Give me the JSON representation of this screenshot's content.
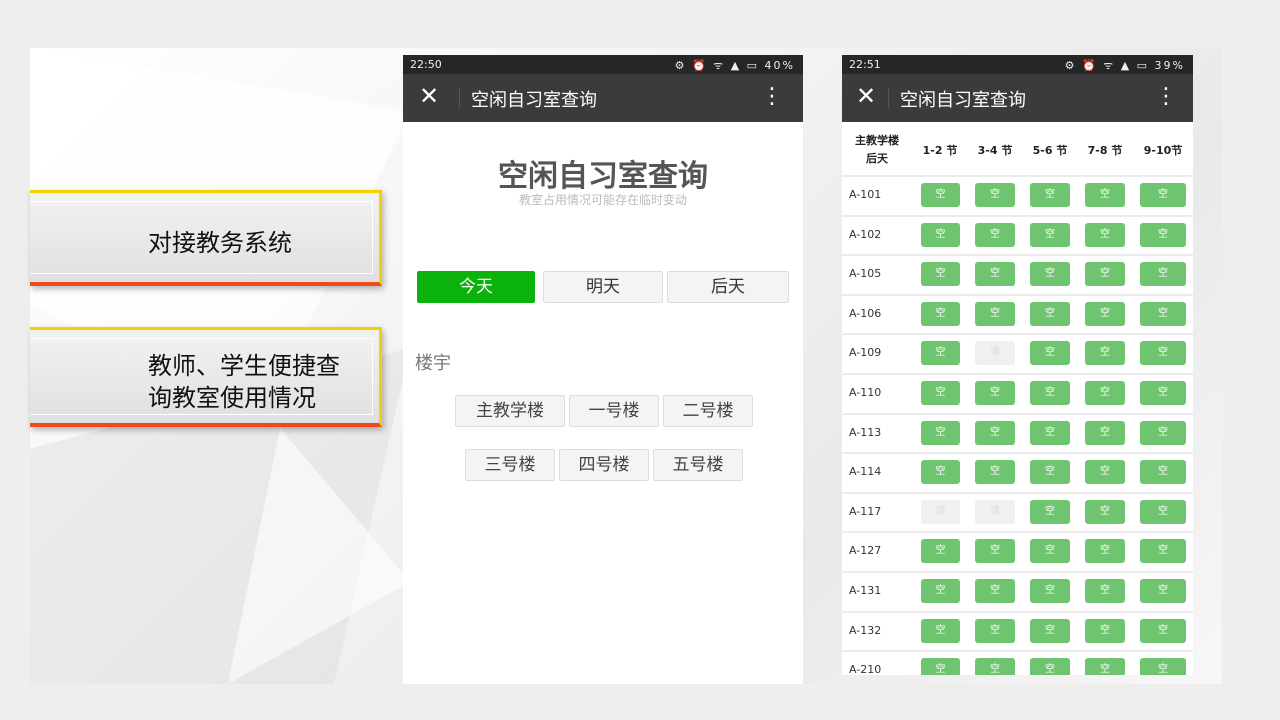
{
  "callouts": [
    {
      "text": "对接教务系统"
    },
    {
      "text": "教师、学生便捷查\n询教室使用情况"
    }
  ],
  "phone1": {
    "status": {
      "time": "22:50",
      "icons": "⚙ ⏰ ᯤ ▲ ▭ 40%"
    },
    "appbar": {
      "close": "✕",
      "title": "空闲自习室查询",
      "more": "⋮"
    },
    "page_title": "空闲自习室查询",
    "subtitle": "教室占用情况可能存在临时变动",
    "day_tabs": [
      {
        "label": "今天",
        "active": true
      },
      {
        "label": "明天",
        "active": false
      },
      {
        "label": "后天",
        "active": false
      }
    ],
    "section_label": "楼宇",
    "buildings_row1": [
      "主教学楼",
      "一号楼",
      "二号楼"
    ],
    "buildings_row2": [
      "三号楼",
      "四号楼",
      "五号楼"
    ],
    "accent": "#0bb20c"
  },
  "phone2": {
    "status": {
      "time": "22:51",
      "icons": "⚙ ⏰ ᯤ ▲ ▭ 39%"
    },
    "appbar": {
      "close": "✕",
      "title": "空闲自习室查询",
      "more": "⋮"
    },
    "header": {
      "corner_line1": "主教学楼",
      "corner_line2": "后天",
      "periods": [
        "1-2 节",
        "3-4 节",
        "5-6 节",
        "7-8 节",
        "9-10节"
      ]
    },
    "free_label": "空",
    "busy_label": "课",
    "rows": [
      {
        "room": "A-101",
        "free": [
          true,
          true,
          true,
          true,
          true
        ]
      },
      {
        "room": "A-102",
        "free": [
          true,
          true,
          true,
          true,
          true
        ]
      },
      {
        "room": "A-105",
        "free": [
          true,
          true,
          true,
          true,
          true
        ]
      },
      {
        "room": "A-106",
        "free": [
          true,
          true,
          true,
          true,
          true
        ]
      },
      {
        "room": "A-109",
        "free": [
          true,
          false,
          true,
          true,
          true
        ]
      },
      {
        "room": "A-110",
        "free": [
          true,
          true,
          true,
          true,
          true
        ]
      },
      {
        "room": "A-113",
        "free": [
          true,
          true,
          true,
          true,
          true
        ]
      },
      {
        "room": "A-114",
        "free": [
          true,
          true,
          true,
          true,
          true
        ]
      },
      {
        "room": "A-117",
        "free": [
          false,
          false,
          true,
          true,
          true
        ]
      },
      {
        "room": "A-127",
        "free": [
          true,
          true,
          true,
          true,
          true
        ]
      },
      {
        "room": "A-131",
        "free": [
          true,
          true,
          true,
          true,
          true
        ]
      },
      {
        "room": "A-132",
        "free": [
          true,
          true,
          true,
          true,
          true
        ]
      },
      {
        "room": "A-210",
        "free": [
          true,
          true,
          true,
          true,
          true
        ]
      }
    ],
    "free_color": "#6ec46f"
  }
}
